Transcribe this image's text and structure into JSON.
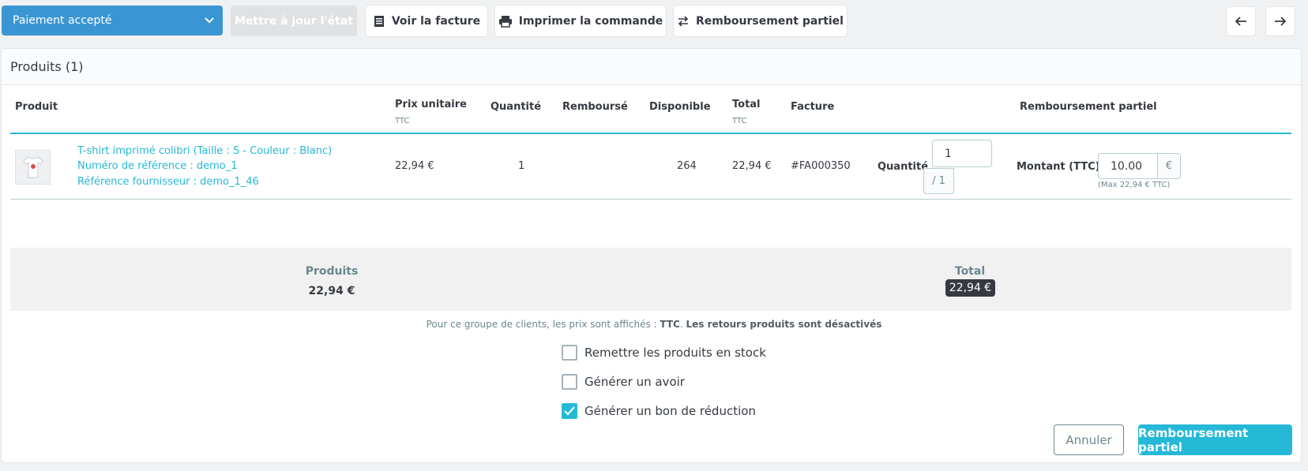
{
  "toolbar": {
    "status_select_value": "Paiement accepté",
    "update_status_label": "Mettre à jour l'état",
    "view_invoice_label": "Voir la facture",
    "print_order_label": "Imprimer la commande",
    "partial_refund_label": "Remboursement partiel"
  },
  "products_panel": {
    "title": "Produits (1)",
    "columns": {
      "product": "Produit",
      "unit_price": "Prix unitaire",
      "unit_price_sub": "TTC",
      "quantity": "Quantité",
      "refunded": "Remboursé",
      "available": "Disponible",
      "total": "Total",
      "total_sub": "TTC",
      "invoice": "Facture",
      "partial_refund": "Remboursement partiel"
    },
    "rows": [
      {
        "name": "T-shirt imprimé colibri (Taille : S - Couleur : Blanc)",
        "reference": "Numéro de référence : demo_1",
        "supplier_reference": "Référence fournisseur : demo_1_46",
        "unit_price": "22,94 €",
        "quantity": "1",
        "refunded": "",
        "available": "264",
        "total": "22,94 €",
        "invoice": "#FA000350",
        "refund_quantity_label": "Quantité",
        "refund_quantity_value": "1",
        "refund_quantity_max": "/ 1",
        "refund_amount_label": "Montant (TTC)",
        "refund_amount_value": "10.00",
        "currency": "€",
        "refund_amount_max": "(Max 22,94 € TTC)"
      }
    ]
  },
  "totals": {
    "products_label": "Produits",
    "products_value": "22,94 €",
    "total_label": "Total",
    "total_value": "22,94 €"
  },
  "notice": {
    "prefix": "Pour ce groupe de clients, les prix sont affichés : ",
    "tax_mode": "TTC",
    "suffix": "Les retours produits sont désactivés"
  },
  "options": [
    {
      "label": "Remettre les produits en stock",
      "checked": false
    },
    {
      "label": "Générer un avoir",
      "checked": false
    },
    {
      "label": "Générer un bon de réduction",
      "checked": true
    }
  ],
  "actions": {
    "cancel_label": "Annuler",
    "submit_label": "Remboursement partiel"
  },
  "colors": {
    "primary": "#25b9d7",
    "status_select": "#3a96d3",
    "dark_badge": "#363a41"
  }
}
